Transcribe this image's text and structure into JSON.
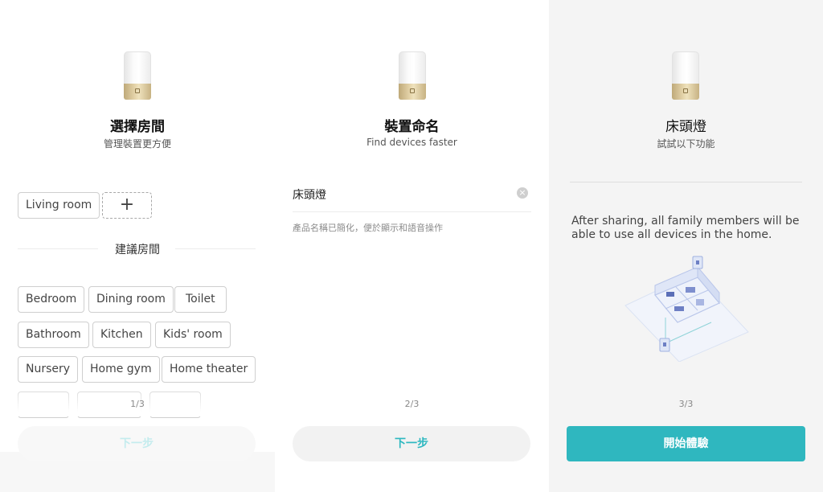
{
  "colors": {
    "accent": "#2fb7bf",
    "accent_disabled": "#c4ecee",
    "chip_border": "#cfcfcf"
  },
  "step1": {
    "title": "選擇房間",
    "subtitle": "管理裝置更方便",
    "selected_rooms": [
      "Living room"
    ],
    "add_symbol": "+",
    "suggested_heading": "建議房間",
    "suggested_rooms": [
      "Bedroom",
      "Dining room",
      "Toilet",
      "Bathroom",
      "Kitchen",
      "Kids' room",
      "Nursery",
      "Home gym",
      "Home theater"
    ],
    "pager": "1/3",
    "next_label": "下一步"
  },
  "step2": {
    "title": "裝置命名",
    "subtitle": "Find devices faster",
    "name_value": "床頭燈",
    "clear_icon": "×",
    "hint": "產品名稱已簡化，便於顯示和語音操作",
    "pager": "2/3",
    "next_label": "下一步"
  },
  "step3": {
    "title": "床頭燈",
    "subtitle": "試試以下功能",
    "share_text": "After sharing, all family members will be able to use all devices in the home.",
    "pager": "3/3",
    "start_label": "開始體驗"
  }
}
